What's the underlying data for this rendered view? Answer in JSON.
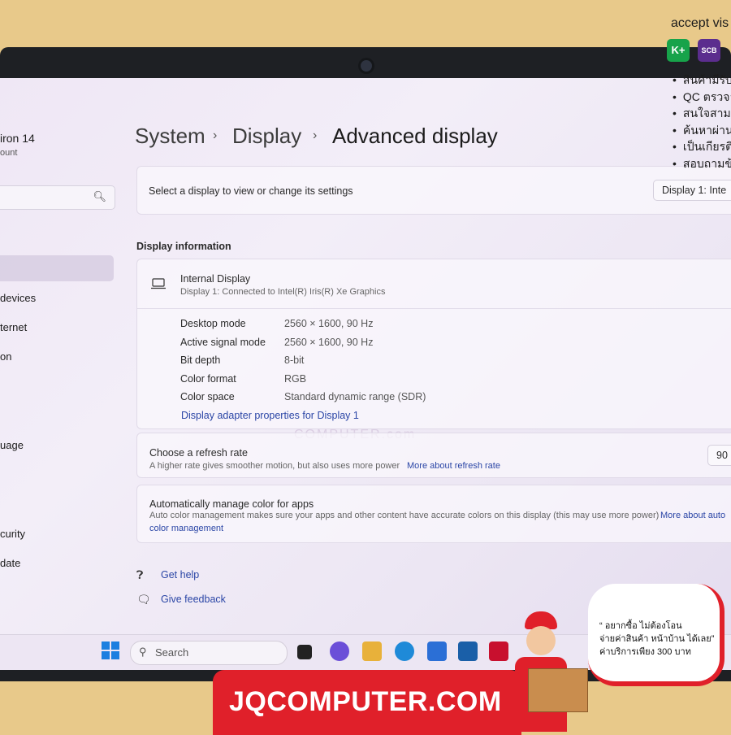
{
  "overlay": {
    "top_text": "accept vis",
    "badges": [
      {
        "name": "kplus",
        "label": "K+",
        "color": "#17a34a"
      },
      {
        "name": "scb",
        "label": "SCB",
        "color": "#5b2d8e"
      }
    ],
    "bullets": [
      "สินค้ามีรับ",
      "QC ตรวจล",
      "สนใจสามาร",
      "ค้นหาผ่าน",
      "เป็นเกียรติ",
      "สอบถามข้"
    ],
    "banner": "JQCOMPUTER.COM",
    "bubble_lines": [
      "“ อยากซื้อ ไม่ต้องโอน",
      "จ่ายค่าสินค้า หน้าบ้าน ได้เลย”",
      "ค่าบริการเพียง 300 บาท"
    ]
  },
  "sidebar": {
    "device_name": "iron 14",
    "account": "ount",
    "items": [
      "devices",
      "ternet",
      "on",
      "uage",
      "curity",
      "date"
    ]
  },
  "breadcrumb": {
    "items": [
      "System",
      "Display"
    ],
    "current": "Advanced display"
  },
  "select_display": {
    "label": "Select a display to view or change its settings",
    "value": "Display 1: Inte"
  },
  "display_info": {
    "heading": "Display information",
    "name": "Internal Display",
    "connection": "Display 1: Connected to Intel(R) Iris(R) Xe Graphics",
    "rows": [
      {
        "key": "Desktop mode",
        "value": "2560 × 1600, 90 Hz"
      },
      {
        "key": "Active signal mode",
        "value": "2560 × 1600, 90 Hz"
      },
      {
        "key": "Bit depth",
        "value": "8-bit"
      },
      {
        "key": "Color format",
        "value": "RGB"
      },
      {
        "key": "Color space",
        "value": "Standard dynamic range (SDR)"
      }
    ],
    "adapter_link": "Display adapter properties for Display 1"
  },
  "refresh": {
    "title": "Choose a refresh rate",
    "desc": "A higher rate gives smoother motion, but also uses more power",
    "link": "More about refresh rate",
    "value": "90"
  },
  "color_manage": {
    "title": "Automatically manage color for apps",
    "desc": "Auto color management makes sure your apps and other content have accurate colors on this display (this may use more power)",
    "link1": "More about auto",
    "link2": "color management"
  },
  "help": {
    "get_help": "Get help",
    "feedback": "Give feedback"
  },
  "taskbar": {
    "search": "Search"
  },
  "watermark": "COMPUTER.com"
}
